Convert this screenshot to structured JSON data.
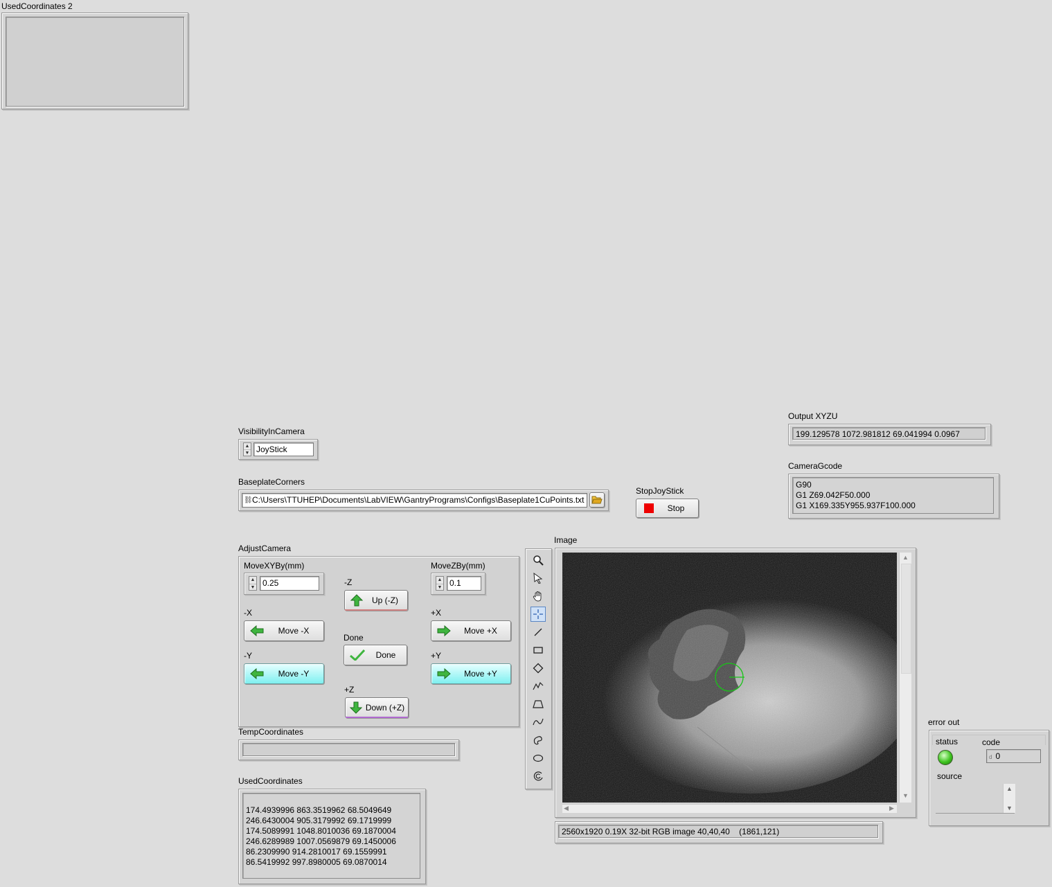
{
  "used_coordinates_2": {
    "label": "UsedCoordinates 2",
    "value": ""
  },
  "visibility": {
    "label": "VisibilityInCamera",
    "value": "JoyStick"
  },
  "baseplate": {
    "label": "BaseplateCorners",
    "path": "C:\\Users\\TTUHEP\\Documents\\LabVIEW\\GantryPrograms\\Configs\\Baseplate1CuPoints.txt"
  },
  "stop_joystick": {
    "label": "StopJoyStick",
    "button": "Stop"
  },
  "output_xyzu": {
    "label": "Output XYZU",
    "value": "199.129578 1072.981812 69.041994 0.0967"
  },
  "camera_gcode": {
    "label": "CameraGcode",
    "lines": "G90\nG1 Z69.042F50.000\nG1 X169.335Y955.937F100.000"
  },
  "adjust_camera": {
    "label": "AdjustCamera",
    "move_xy": {
      "label": "MoveXYBy(mm)",
      "value": "0.25"
    },
    "move_z": {
      "label": "MoveZBy(mm)",
      "value": "0.1"
    },
    "minus_z": {
      "label": "-Z",
      "button": "Up (-Z)"
    },
    "minus_x": {
      "label": "-X",
      "button": "Move  -X"
    },
    "plus_x": {
      "label": "+X",
      "button": "Move +X"
    },
    "done": {
      "label": "Done",
      "button": "Done"
    },
    "minus_y": {
      "label": "-Y",
      "button": "Move  -Y"
    },
    "plus_y": {
      "label": "+Y",
      "button": "Move  +Y"
    },
    "plus_z": {
      "label": "+Z",
      "button": "Down (+Z)"
    }
  },
  "temp_coordinates": {
    "label": "TempCoordinates",
    "value": ""
  },
  "used_coordinates": {
    "label": "UsedCoordinates",
    "lines": "174.4939996 863.3519962 68.5049649\n246.6430004 905.3179992 69.1719999\n174.5089991 1048.8010036 69.1870004\n246.6289989 1007.0569879 69.1450006\n86.2309990 914.2810017 69.1559991\n86.5419992 997.8980005 69.0870014"
  },
  "image": {
    "label": "Image",
    "status": "2560x1920 0.19X 32-bit RGB image 40,40,40    (1861,121)",
    "tools": [
      "zoom-icon",
      "pointer-icon",
      "pan-hand-icon",
      "crosshair-icon",
      "line-icon",
      "rectangle-icon",
      "rotated-rect-icon",
      "polyline-icon",
      "polygon-icon",
      "freehand-line-icon",
      "freehand-region-icon",
      "oval-icon",
      "annulus-icon"
    ]
  },
  "error_out": {
    "label": "error out",
    "status_label": "status",
    "code_label": "code",
    "code_prefix": "d",
    "code_value": "0",
    "source_label": "source",
    "status_color": "#3ec41f"
  }
}
